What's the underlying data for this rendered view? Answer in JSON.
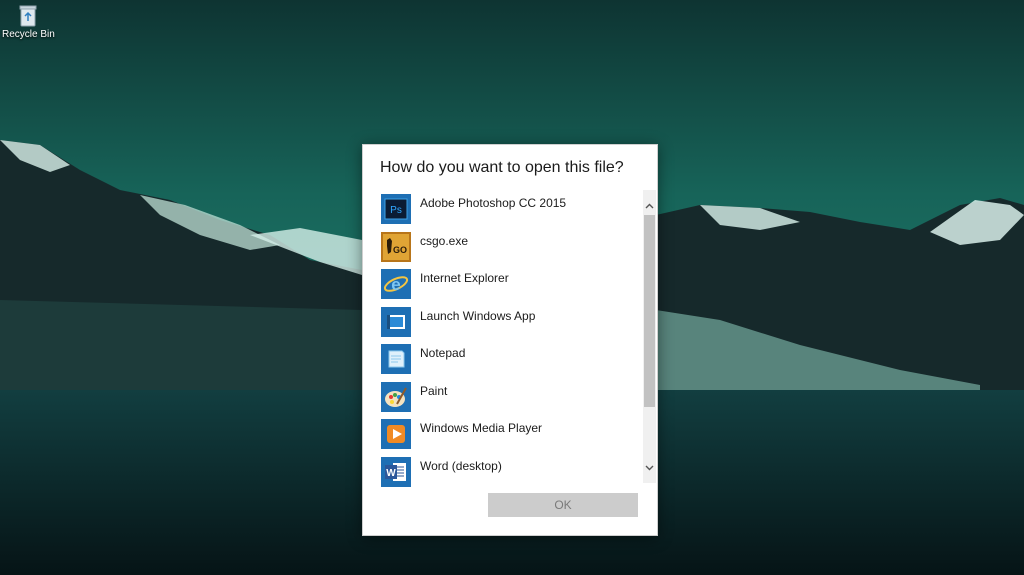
{
  "desktop": {
    "icons": [
      {
        "label": "Recycle Bin",
        "icon": "recycle-bin-icon"
      }
    ]
  },
  "dialog": {
    "title": "How do you want to open this file?",
    "apps": [
      {
        "label": "Adobe Photoshop CC 2015",
        "icon": "photoshop-icon",
        "badge": "Ps"
      },
      {
        "label": "csgo.exe",
        "icon": "csgo-icon",
        "badge": "GO"
      },
      {
        "label": "Internet Explorer",
        "icon": "internet-explorer-icon",
        "badge": "e"
      },
      {
        "label": "Launch Windows App",
        "icon": "windows-app-icon"
      },
      {
        "label": "Notepad",
        "icon": "notepad-icon"
      },
      {
        "label": "Paint",
        "icon": "paint-icon"
      },
      {
        "label": "Windows Media Player",
        "icon": "media-player-icon"
      },
      {
        "label": "Word (desktop)",
        "icon": "word-icon",
        "badge": "W"
      }
    ],
    "ok_label": "OK"
  },
  "colors": {
    "tile_blue": "#1e6fb4",
    "ok_disabled_bg": "#cccccc",
    "ok_disabled_text": "#7a7a7a",
    "scroll_thumb": "#c2c2c2"
  }
}
